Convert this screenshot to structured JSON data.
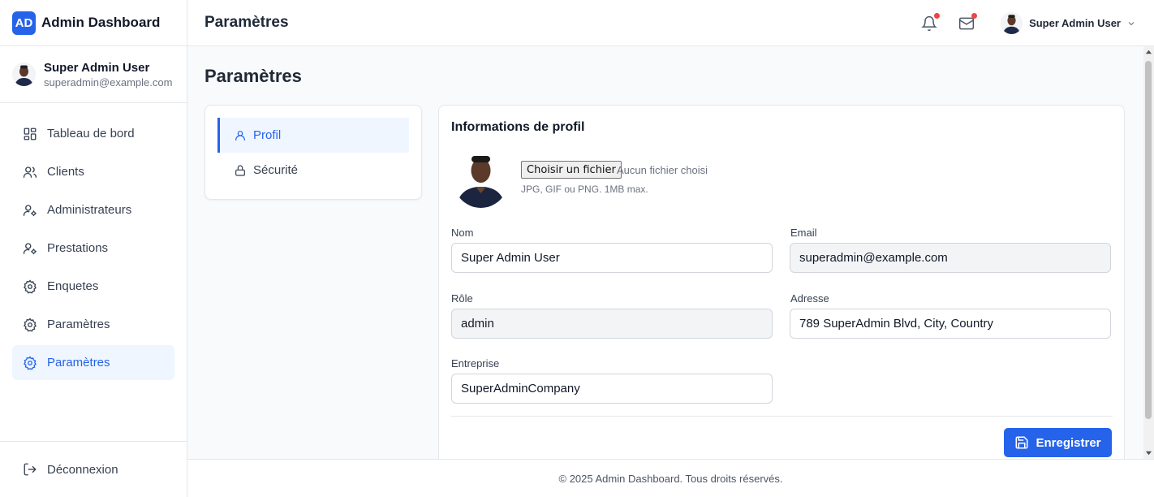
{
  "brand": {
    "logo": "AD",
    "title": "Admin Dashboard"
  },
  "user": {
    "name": "Super Admin User",
    "email": "superadmin@example.com"
  },
  "sidebar": {
    "items": [
      {
        "label": "Tableau de bord",
        "icon": "dashboard-icon"
      },
      {
        "label": "Clients",
        "icon": "users-icon"
      },
      {
        "label": "Administrateurs",
        "icon": "user-cog-icon"
      },
      {
        "label": "Prestations",
        "icon": "user-cog-icon"
      },
      {
        "label": "Enquetes",
        "icon": "gear-icon"
      },
      {
        "label": "Paramètres",
        "icon": "gear-icon"
      },
      {
        "label": "Paramètres",
        "icon": "gear-icon",
        "active": true
      }
    ],
    "logout_label": "Déconnexion"
  },
  "header": {
    "title": "Paramètres",
    "user_name": "Super Admin User"
  },
  "page": {
    "title": "Paramètres",
    "settings_nav": [
      {
        "label": "Profil",
        "icon": "user-icon",
        "active": true
      },
      {
        "label": "Sécurité",
        "icon": "lock-icon"
      }
    ]
  },
  "profile": {
    "title": "Informations de profil",
    "file_button": "Choisir un fichier",
    "file_status": "Aucun fichier choisi",
    "file_hint": "JPG, GIF ou PNG. 1MB max.",
    "fields": {
      "nom": {
        "label": "Nom",
        "value": "Super Admin User"
      },
      "email": {
        "label": "Email",
        "value": "superadmin@example.com"
      },
      "role": {
        "label": "Rôle",
        "value": "admin"
      },
      "adresse": {
        "label": "Adresse",
        "value": "789 SuperAdmin Blvd, City, Country"
      },
      "entreprise": {
        "label": "Entreprise",
        "value": "SuperAdminCompany"
      }
    },
    "save_label": "Enregistrer"
  },
  "footer": {
    "text": "© 2025 Admin Dashboard. Tous droits réservés."
  },
  "colors": {
    "accent": "#2563eb",
    "accent_bg": "#eff6ff",
    "notification_dot": "#ef4444"
  }
}
